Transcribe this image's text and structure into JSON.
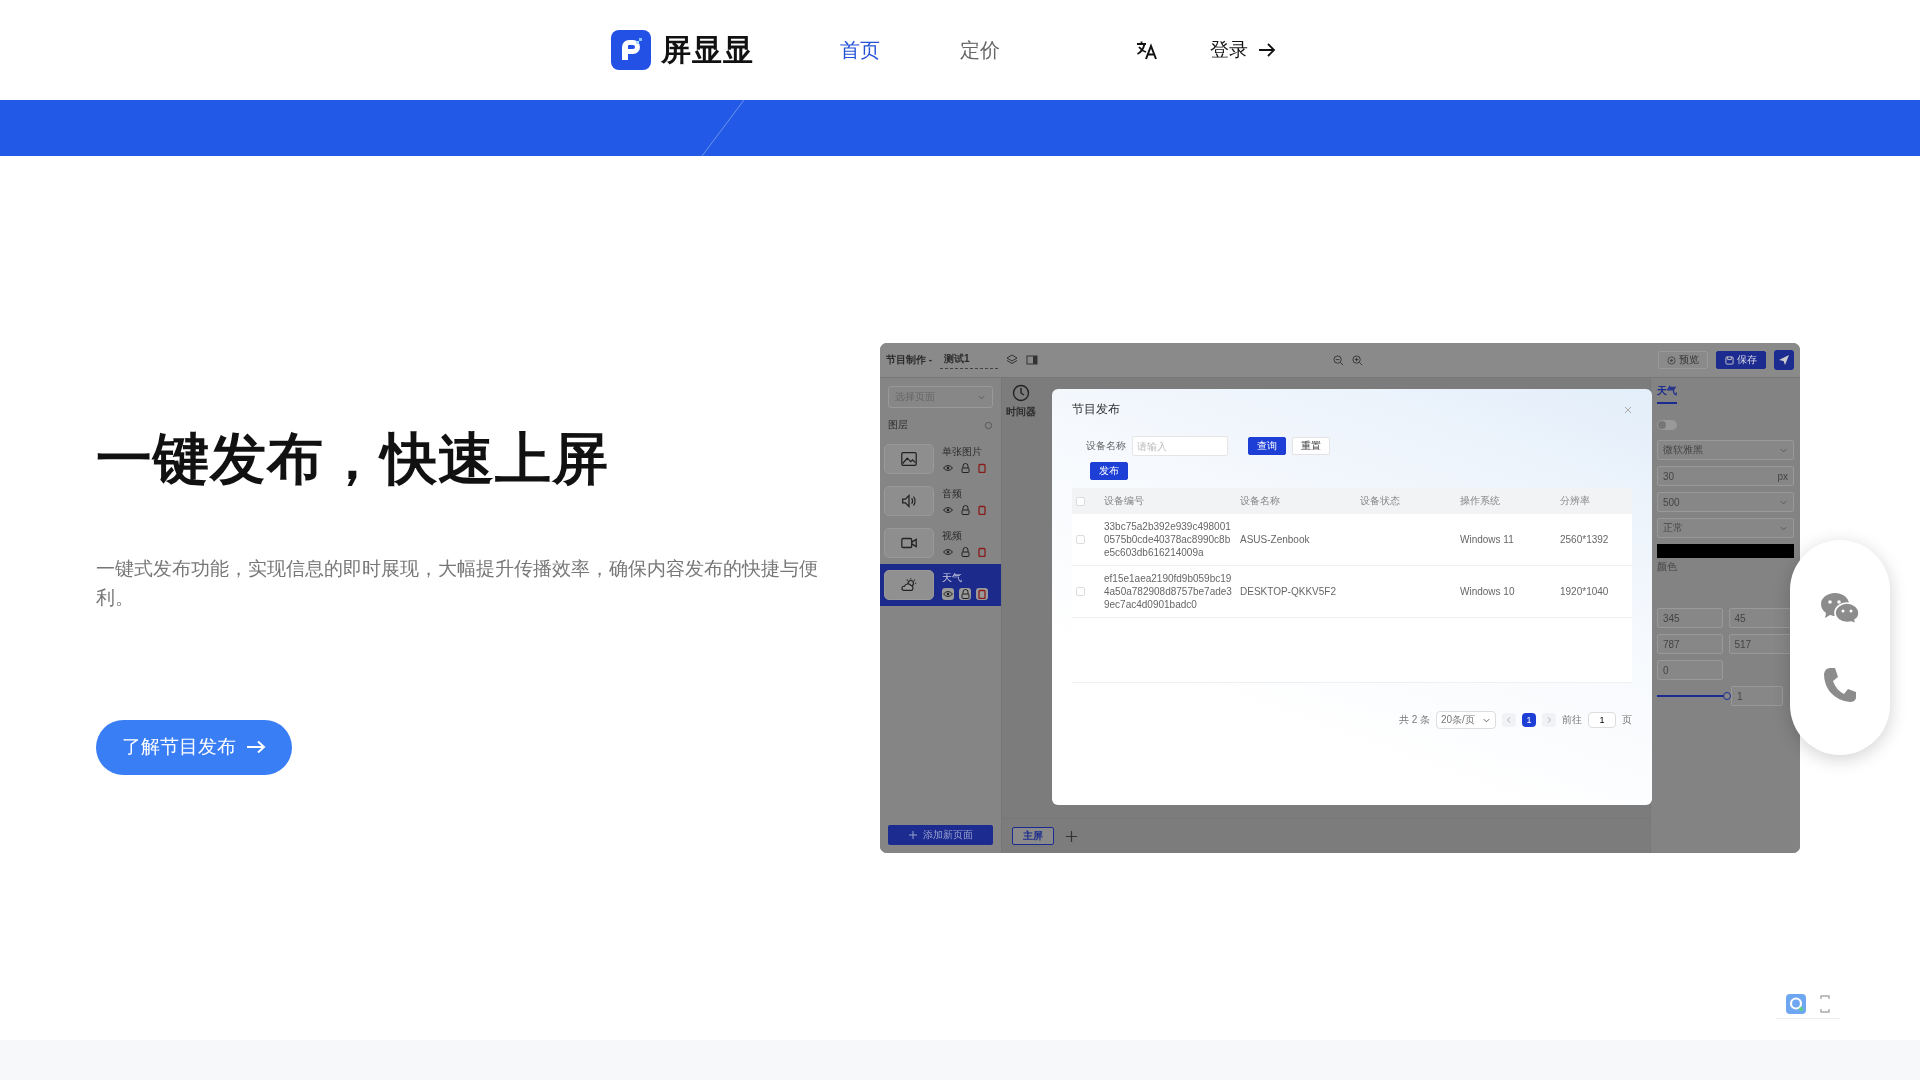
{
  "header": {
    "logo_text": "屏显显",
    "nav": [
      {
        "label": "首页",
        "selected": true
      },
      {
        "label": "定价",
        "selected": false
      }
    ],
    "login": "登录"
  },
  "hero": {
    "title": "一键发布，快速上屏",
    "description": "一键式发布功能，实现信息的即时展现，大幅提升传播效率，确保内容发布的快捷与便利。",
    "button": "了解节目发布"
  },
  "app_mock": {
    "breadcrumb": "节目制作 -",
    "project": "测试1",
    "page_select_placeholder": "选择页面",
    "layers_title": "图层",
    "layers": [
      {
        "name": "单张图片",
        "kind": "image",
        "selected": false
      },
      {
        "name": "音频",
        "kind": "audio",
        "selected": false
      },
      {
        "name": "视频",
        "kind": "video",
        "selected": false
      },
      {
        "name": "天气",
        "kind": "weather",
        "selected": true
      }
    ],
    "add_page": "添加新页面",
    "tool_label": "时间器",
    "screen_tab": "主屏",
    "preview": "预览",
    "save": "保存",
    "panel_tab": "天气",
    "toggle": {
      "on": false
    },
    "font_family": "微软雅黑",
    "font_size": "30",
    "font_unit": "px",
    "font_weight": "500",
    "font_style": "正常",
    "color_label": "颜色",
    "fields": [
      "345",
      "45",
      "787",
      "517",
      "0"
    ],
    "slider": {
      "level": 1,
      "value": "1"
    },
    "modal": {
      "title": "节目发布",
      "search_label": "设备名称",
      "search_placeholder": "请输入",
      "query": "查询",
      "reset": "重置",
      "publish": "发布",
      "select_all_checked": false,
      "columns": [
        "设备编号",
        "设备名称",
        "设备状态",
        "操作系统",
        "分辨率"
      ],
      "rows": [
        {
          "checked": false,
          "device_id": "33bc75a2b392e939c4980010575b0cde40378ac8990c8be5c603db616214009a",
          "device_name": "ASUS-Zenbook",
          "os": "Windows 11",
          "resolution": "2560*1392"
        },
        {
          "checked": false,
          "device_id": "ef15e1aea2190fd9b059bc194a50a782908d8757be7ade39ec7ac4d0901badc0",
          "device_name": "DESKTOP-QKKV5F2",
          "os": "Windows 10",
          "resolution": "1920*1040"
        }
      ],
      "total": "共 2 条",
      "page_size": "20条/页",
      "pages": [
        {
          "label": "1",
          "selected": true
        }
      ],
      "goto": "前往",
      "goto_value": "1",
      "page_unit": "页"
    }
  }
}
